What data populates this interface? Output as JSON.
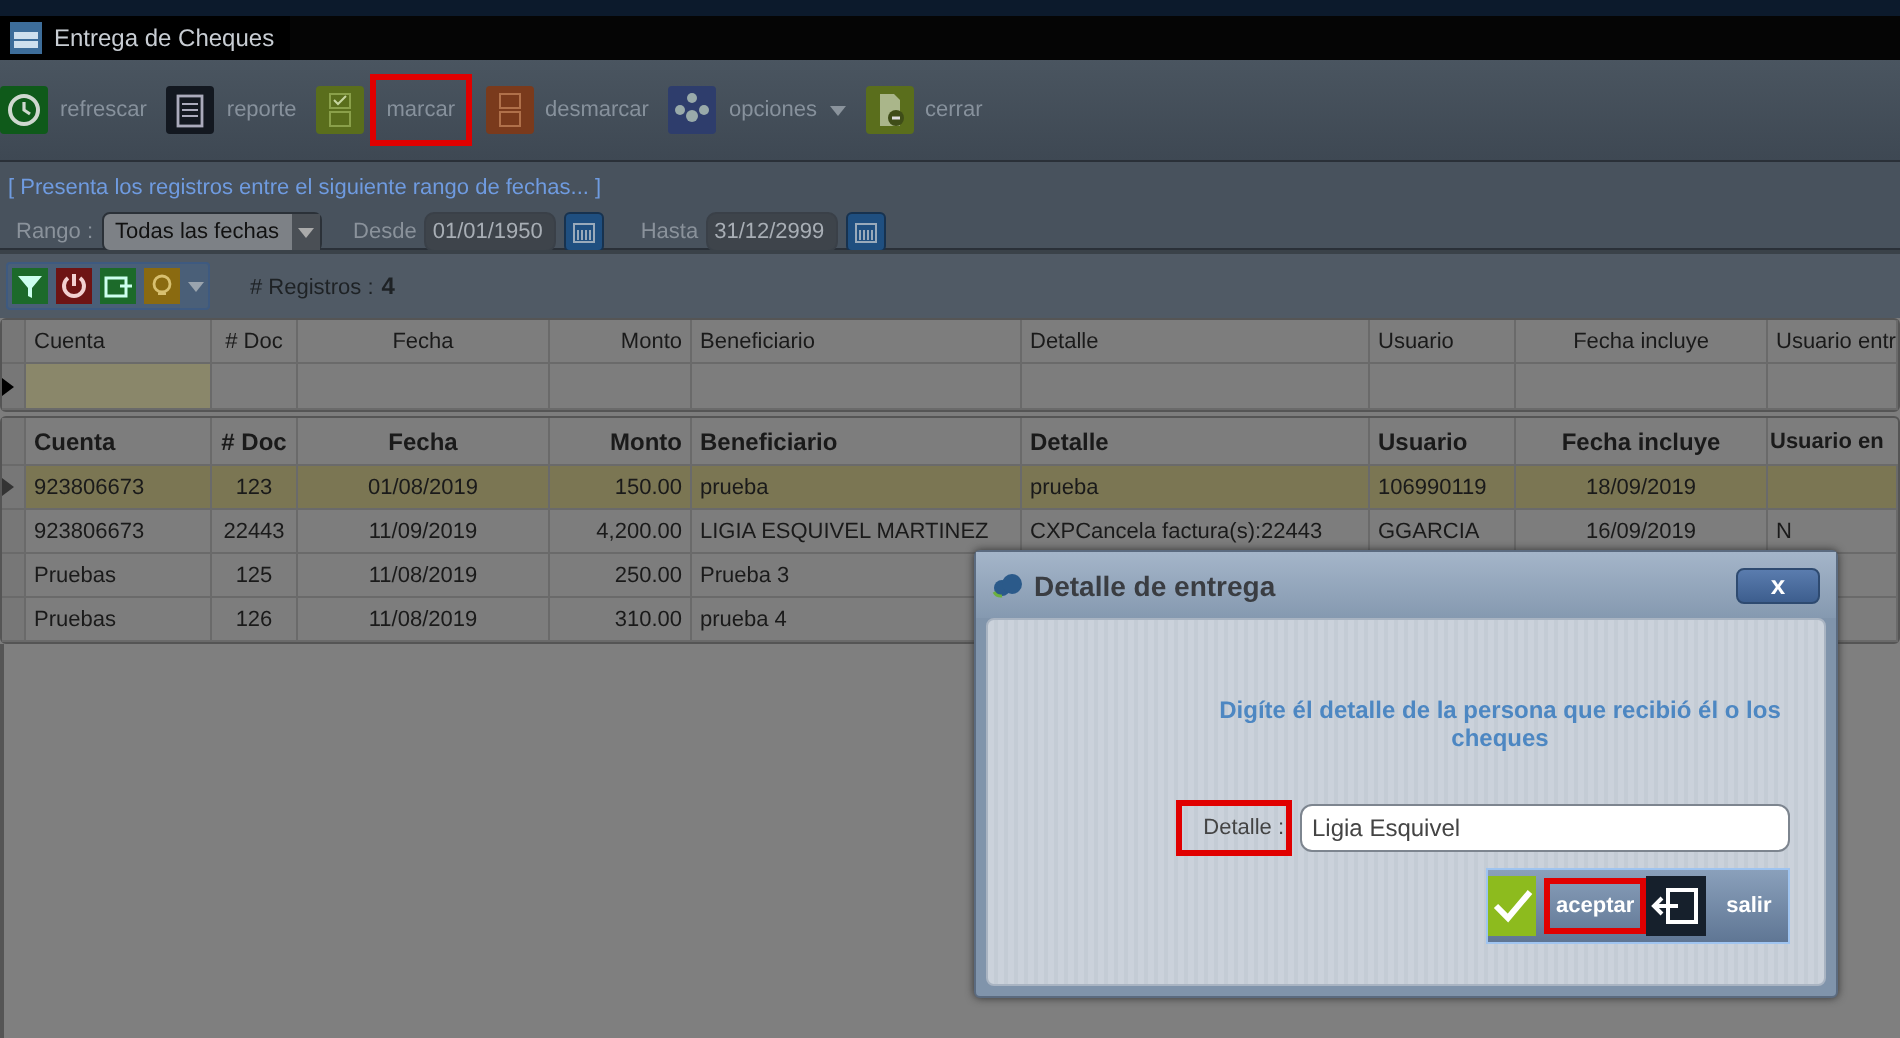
{
  "window": {
    "title": "Entrega de Cheques"
  },
  "toolbar": [
    {
      "kind": "refresh",
      "label": "refrescar",
      "highlighted": false
    },
    {
      "kind": "report",
      "label": "reporte",
      "highlighted": false
    },
    {
      "kind": "mark",
      "label": "marcar",
      "highlighted": true
    },
    {
      "kind": "unmark",
      "label": "desmarcar",
      "highlighted": false
    },
    {
      "kind": "options",
      "label": "opciones",
      "highlighted": false
    },
    {
      "kind": "close",
      "label": "cerrar",
      "highlighted": false
    }
  ],
  "filter": {
    "legend": "[ Presenta los registros entre el siguiente rango de fechas... ]",
    "range_label": "Rango :",
    "range_value": "Todas las fechas",
    "from_label": "Desde",
    "from_value": "01/01/1950",
    "from_disabled": true,
    "to_label": "Hasta",
    "to_value": "31/12/2999",
    "to_disabled": true
  },
  "grid_toolbar": {
    "buttons": [
      {
        "kind": "filter"
      },
      {
        "kind": "power"
      },
      {
        "kind": "export"
      },
      {
        "kind": "bulb"
      }
    ],
    "count_label": "# Registros :",
    "count": "4"
  },
  "filter_grid": {
    "columns": [
      "Cuenta",
      "# Doc",
      "Fecha",
      "Monto",
      "Beneficiario",
      "Detalle",
      "Usuario",
      "Fecha incluye",
      "Usuario entr"
    ]
  },
  "table": {
    "columns": [
      "Cuenta",
      "# Doc",
      "Fecha",
      "Monto",
      "Beneficiario",
      "Detalle",
      "Usuario",
      "Fecha incluye",
      "Usuario en"
    ],
    "rows": [
      {
        "selected": true,
        "cells": [
          "923806673",
          "123",
          "01/08/2019",
          "150.00",
          "prueba",
          "prueba",
          "106990119",
          "18/09/2019"
        ]
      },
      {
        "selected": false,
        "cells": [
          "923806673",
          "22443",
          "11/09/2019",
          "4,200.00",
          "LIGIA ESQUIVEL MARTINEZ",
          "CXPCancela factura(s):22443",
          "GGARCIA",
          "16/09/2019",
          "N"
        ]
      },
      {
        "selected": false,
        "cells": [
          "Pruebas",
          "125",
          "11/08/2019",
          "250.00",
          "Prueba 3"
        ]
      },
      {
        "selected": false,
        "cells": [
          "Pruebas",
          "126",
          "11/08/2019",
          "310.00",
          "prueba 4"
        ]
      }
    ]
  },
  "dialog": {
    "title": "Detalle de entrega",
    "close": "x",
    "message": "Digíte él detalle de la persona que recibió él o los cheques",
    "field_label": "Detalle :",
    "label_highlighted": true,
    "field_value": "Ligia Esquivel",
    "buttons": [
      {
        "kind": "accept",
        "label": "aceptar",
        "highlighted": true
      },
      {
        "kind": "exit",
        "label": "salir",
        "highlighted": false
      }
    ]
  }
}
